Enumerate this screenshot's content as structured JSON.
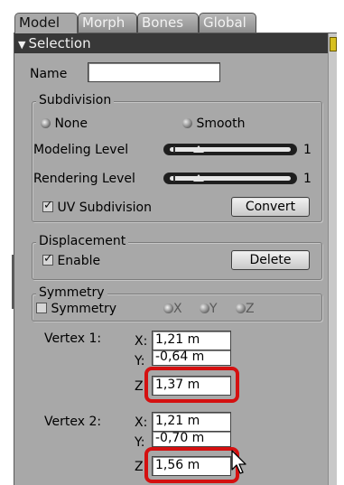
{
  "tabs": [
    "Model",
    "Morph",
    "Bones",
    "Global"
  ],
  "section": {
    "title": "Selection",
    "arrow_icon": "triangle-down-icon"
  },
  "name_field": {
    "label": "Name",
    "value": ""
  },
  "subdivision": {
    "legend": "Subdivision",
    "options": [
      "None",
      "Smooth"
    ],
    "selected": "None",
    "modeling_label": "Modeling Level",
    "modeling_value": "1",
    "rendering_label": "Rendering Level",
    "rendering_value": "1",
    "uv_label": "UV Subdivision",
    "uv_checked": true,
    "convert_label": "Convert"
  },
  "displacement": {
    "legend": "Displacement",
    "enable_label": "Enable",
    "enable_checked": true,
    "delete_label": "Delete"
  },
  "symmetry": {
    "legend": "Symmetry",
    "checkbox_label": "Symmetry",
    "checked": false,
    "axes": [
      "X",
      "Y",
      "Z"
    ]
  },
  "vertex1": {
    "label": "Vertex 1:",
    "x_label": "X:",
    "x": "1,21 m",
    "y_label": "Y:",
    "y": "-0,64 m",
    "z_label": "Z",
    "z": "1,37 m"
  },
  "vertex2": {
    "label": "Vertex 2:",
    "x_label": "X:",
    "x": "1,21 m",
    "y_label": "Y:",
    "y": "-0,70 m",
    "z_label": "Z",
    "z": "1,56 m"
  },
  "colors": {
    "panel": "#a8a8a8",
    "header": "#383838",
    "highlight": "#d41010"
  }
}
